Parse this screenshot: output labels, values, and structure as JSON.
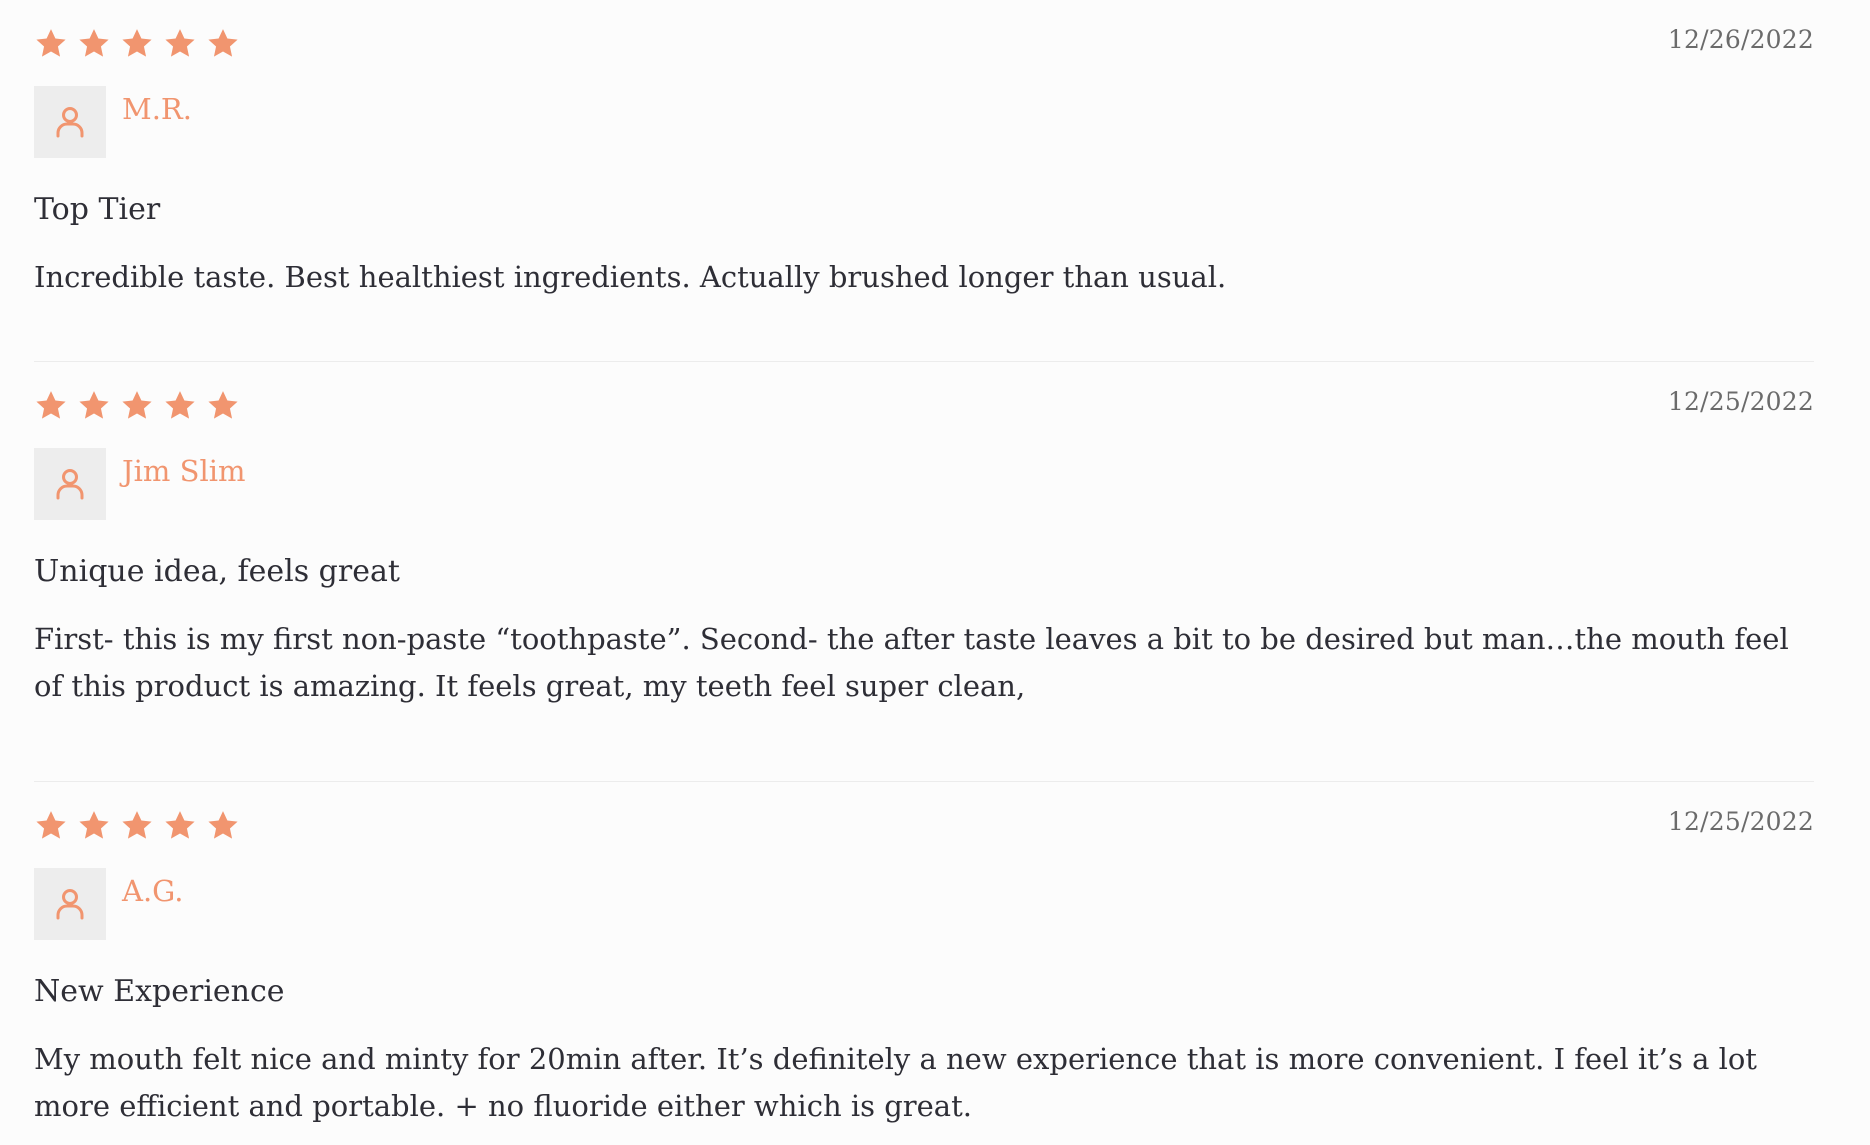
{
  "accent_color": "#f1956f",
  "reviews": [
    {
      "rating": 5,
      "date": "12/26/2022",
      "reviewer": "M.R.",
      "avatar_icon": "user-icon",
      "title": "Top Tier",
      "body": "Incredible taste. Best healthiest ingredients. Actually brushed longer than usual."
    },
    {
      "rating": 5,
      "date": "12/25/2022",
      "reviewer": "Jim Slim",
      "avatar_icon": "user-icon",
      "title": "Unique idea, feels great",
      "body": "First- this is my first non-paste “toothpaste”. Second- the after taste leaves a bit to be desired but man…the mouth feel of this product is amazing. It feels great, my teeth feel super clean,"
    },
    {
      "rating": 5,
      "date": "12/25/2022",
      "reviewer": "A.G.",
      "avatar_icon": "user-icon",
      "title": "New Experience",
      "body": "My mouth felt nice and minty for 20min after. It’s definitely a new experience that is more convenient. I feel it’s a lot more efficient and portable. + no fluoride either which is great."
    }
  ]
}
